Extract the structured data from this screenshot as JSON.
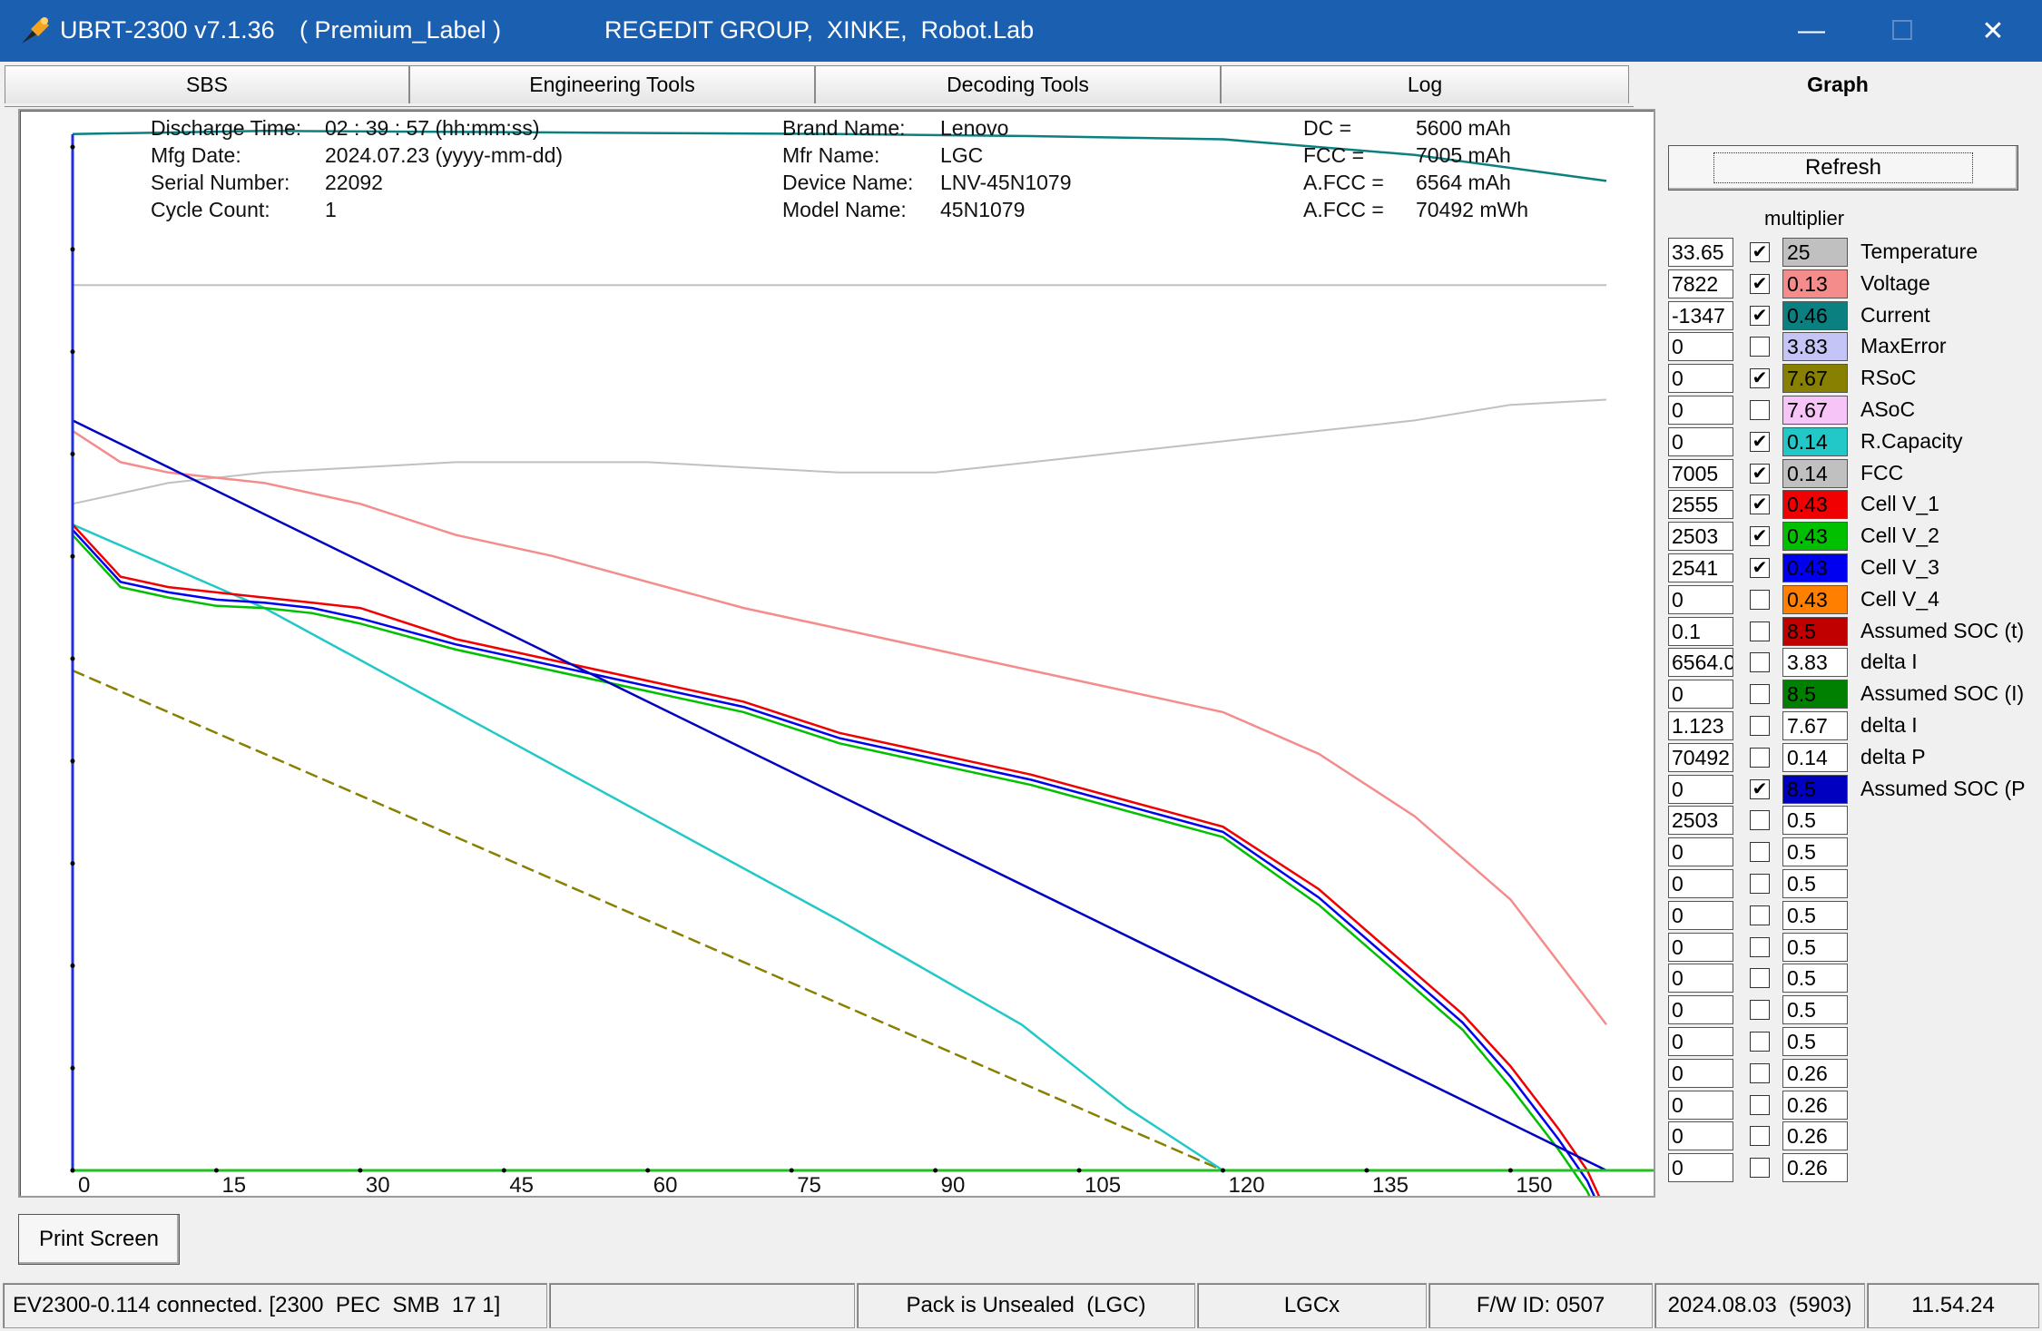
{
  "window": {
    "app_title": "UBRT-2300 v7.1.36",
    "label": "( Premium_Label )",
    "group": "REGEDIT GROUP,  XINKE,  Robot.Lab",
    "minimize": "—",
    "maximize": "☐",
    "close": "✕"
  },
  "tabs": [
    "SBS",
    "Engineering Tools",
    "Decoding Tools",
    "Log",
    "Graph"
  ],
  "active_tab": "Graph",
  "info": {
    "discharge_time_label": "Discharge Time:",
    "discharge_time_value": "02 : 39 : 57 (hh:mm:ss)",
    "mfg_date_label": "Mfg Date:",
    "mfg_date_value": "2024.07.23 (yyyy-mm-dd)",
    "serial_label": "Serial Number:",
    "serial_value": "22092",
    "cycle_label": "Cycle Count:",
    "cycle_value": "1",
    "brand_label": "Brand Name:",
    "brand_value": "Lenovo",
    "mfr_label": "Mfr Name:",
    "mfr_value": "LGC",
    "device_label": "Device Name:",
    "device_value": "LNV-45N1079",
    "model_label": "Model Name:",
    "model_value": "45N1079",
    "dc_label": "DC =",
    "dc_value": "5600 mAh",
    "fcc_label": "FCC =",
    "fcc_value": "7005 mAh",
    "afcc1_label": "A.FCC =",
    "afcc1_value": "6564 mAh",
    "afcc2_label": "A.FCC =",
    "afcc2_value": "70492 mWh"
  },
  "refresh_label": "Refresh",
  "multiplier_label": "multiplier",
  "channels": [
    {
      "value": "33.65",
      "checked": true,
      "mult": "25",
      "color": "#c0c0c0",
      "label": "Temperature"
    },
    {
      "value": "7822",
      "checked": true,
      "mult": "0.13",
      "color": "#f48c8c",
      "label": "Voltage"
    },
    {
      "value": "-1347",
      "checked": true,
      "mult": "0.46",
      "color": "#0b8080",
      "label": "Current"
    },
    {
      "value": "0",
      "checked": false,
      "mult": "3.83",
      "color": "#c4c4f6",
      "label": "MaxError"
    },
    {
      "value": "0",
      "checked": true,
      "mult": "7.67",
      "color": "#888000",
      "label": "RSoC"
    },
    {
      "value": "0",
      "checked": false,
      "mult": "7.67",
      "color": "#f6c4f6",
      "label": "ASoC"
    },
    {
      "value": "0",
      "checked": true,
      "mult": "0.14",
      "color": "#22c8c8",
      "label": "R.Capacity"
    },
    {
      "value": "7005",
      "checked": true,
      "mult": "0.14",
      "color": "#c0c0c0",
      "label": "FCC"
    },
    {
      "value": "2555",
      "checked": true,
      "mult": "0.43",
      "color": "#f00000",
      "label": "Cell V_1"
    },
    {
      "value": "2503",
      "checked": true,
      "mult": "0.43",
      "color": "#00c000",
      "label": "Cell V_2"
    },
    {
      "value": "2541",
      "checked": true,
      "mult": "0.43",
      "color": "#0000f0",
      "label": "Cell V_3"
    },
    {
      "value": "0",
      "checked": false,
      "mult": "0.43",
      "color": "#ff8000",
      "label": "Cell V_4"
    },
    {
      "value": "0.1",
      "checked": false,
      "mult": "8.5",
      "color": "#c00000",
      "label": "Assumed SOC (t)"
    },
    {
      "value": "6564.0",
      "checked": false,
      "mult": "3.83",
      "color": "#ffffff",
      "label": "delta I"
    },
    {
      "value": "0",
      "checked": false,
      "mult": "8.5",
      "color": "#008000",
      "label": "Assumed SOC (I)"
    },
    {
      "value": "1.123",
      "checked": false,
      "mult": "7.67",
      "color": "#ffffff",
      "label": "delta I"
    },
    {
      "value": "70492",
      "checked": false,
      "mult": "0.14",
      "color": "#ffffff",
      "label": "delta P"
    },
    {
      "value": "0",
      "checked": true,
      "mult": "8.5",
      "color": "#0000c0",
      "label": "Assumed SOC (P"
    },
    {
      "value": "2503",
      "checked": false,
      "mult": "0.5",
      "color": "#ffffff",
      "label": ""
    },
    {
      "value": "0",
      "checked": false,
      "mult": "0.5",
      "color": "#ffffff",
      "label": ""
    },
    {
      "value": "0",
      "checked": false,
      "mult": "0.5",
      "color": "#ffffff",
      "label": ""
    },
    {
      "value": "0",
      "checked": false,
      "mult": "0.5",
      "color": "#ffffff",
      "label": ""
    },
    {
      "value": "0",
      "checked": false,
      "mult": "0.5",
      "color": "#ffffff",
      "label": ""
    },
    {
      "value": "0",
      "checked": false,
      "mult": "0.5",
      "color": "#ffffff",
      "label": ""
    },
    {
      "value": "0",
      "checked": false,
      "mult": "0.5",
      "color": "#ffffff",
      "label": ""
    },
    {
      "value": "0",
      "checked": false,
      "mult": "0.5",
      "color": "#ffffff",
      "label": ""
    },
    {
      "value": "0",
      "checked": false,
      "mult": "0.26",
      "color": "#ffffff",
      "label": ""
    },
    {
      "value": "0",
      "checked": false,
      "mult": "0.26",
      "color": "#ffffff",
      "label": ""
    },
    {
      "value": "0",
      "checked": false,
      "mult": "0.26",
      "color": "#ffffff",
      "label": ""
    },
    {
      "value": "0",
      "checked": false,
      "mult": "0.26",
      "color": "#ffffff",
      "label": ""
    }
  ],
  "print_button": "Print Screen",
  "status": {
    "connection": "EV2300-0.114 connected. [2300  PEC  SMB  17 1]",
    "empty": "",
    "seal": "Pack is Unsealed  (LGC)",
    "chem": "LGCx",
    "fw": "F/W ID: 0507",
    "date": "2024.08.03  (5903)",
    "time": "11.54.24"
  },
  "chart_data": {
    "type": "line",
    "x_ticks": [
      "0",
      "15",
      "30",
      "45",
      "60",
      "75",
      "90",
      "105",
      "120",
      "135",
      "150"
    ],
    "xlim": [
      0,
      160
    ],
    "ylim": [
      0,
      100
    ],
    "series": [
      {
        "name": "Temperature",
        "color": "#c0c0c0",
        "x": [
          0,
          10,
          20,
          30,
          40,
          50,
          60,
          70,
          80,
          90,
          100,
          110,
          120,
          130,
          140,
          150,
          160
        ],
        "y": [
          64,
          66,
          67,
          67.5,
          68,
          68,
          68,
          67.5,
          67,
          67,
          68,
          69,
          70,
          71,
          72,
          73.5,
          74
        ]
      },
      {
        "name": "Voltage",
        "color": "#f48c8c",
        "x": [
          0,
          5,
          10,
          20,
          30,
          40,
          50,
          60,
          70,
          80,
          90,
          100,
          110,
          120,
          130,
          140,
          150,
          155,
          160
        ],
        "y": [
          71,
          68,
          67,
          66,
          64,
          61,
          59,
          56.5,
          54,
          52,
          50,
          48,
          46,
          44,
          40,
          34,
          26,
          20,
          14
        ]
      },
      {
        "name": "Current",
        "color": "#0b8080",
        "x": [
          0,
          20,
          40,
          60,
          80,
          100,
          120,
          140,
          160
        ],
        "y": [
          99.5,
          99.8,
          99.7,
          99.6,
          99.5,
          99.3,
          99,
          97.5,
          95
        ]
      },
      {
        "name": "RSoC",
        "color": "#888000",
        "x": [
          0,
          120
        ],
        "y": [
          48,
          0
        ]
      },
      {
        "name": "R.Capacity",
        "color": "#22c8c8",
        "x": [
          0,
          20,
          40,
          60,
          80,
          99,
          110,
          120
        ],
        "y": [
          62,
          54,
          44,
          34,
          24,
          14,
          6,
          0
        ]
      },
      {
        "name": "FCC",
        "color": "#c0c0c0",
        "x": [
          0,
          160
        ],
        "y": [
          85,
          85
        ]
      },
      {
        "name": "Cell V_1",
        "color": "#f00000",
        "x": [
          0,
          5,
          10,
          15,
          20,
          25,
          30,
          40,
          50,
          60,
          70,
          80,
          90,
          100,
          110,
          120,
          130,
          135,
          140,
          145,
          150,
          155,
          158,
          160
        ],
        "y": [
          62,
          57,
          56,
          55.5,
          55,
          54.5,
          54,
          51,
          49,
          47,
          45,
          42,
          40,
          38,
          35.5,
          33,
          27,
          23,
          19,
          15,
          10,
          4,
          0,
          -4
        ]
      },
      {
        "name": "Cell V_2",
        "color": "#00c000",
        "x": [
          0,
          5,
          10,
          15,
          20,
          25,
          30,
          40,
          50,
          60,
          70,
          80,
          90,
          100,
          110,
          120,
          130,
          135,
          140,
          145,
          150,
          155,
          158,
          160
        ],
        "y": [
          61,
          56,
          55,
          54.2,
          54,
          53.5,
          52.5,
          50,
          48,
          46,
          44,
          41,
          39,
          37,
          34.5,
          32,
          25.5,
          21.5,
          17.5,
          13.5,
          8,
          2,
          -2,
          -6
        ]
      },
      {
        "name": "Cell V_3",
        "color": "#0000f0",
        "x": [
          0,
          5,
          10,
          15,
          20,
          25,
          30,
          40,
          50,
          60,
          70,
          80,
          90,
          100,
          110,
          120,
          130,
          135,
          140,
          145,
          150,
          155,
          158,
          160
        ],
        "y": [
          61.5,
          56.5,
          55.5,
          54.8,
          54.5,
          54,
          53,
          50.5,
          48.5,
          46.5,
          44.5,
          41.5,
          39.5,
          37.5,
          35,
          32.5,
          26.2,
          22.2,
          18.2,
          14.2,
          9,
          3,
          -1,
          -5
        ]
      },
      {
        "name": "Assumed SOC (P",
        "color": "#0000c0",
        "x": [
          0,
          160
        ],
        "y": [
          72,
          0
        ]
      },
      {
        "name": "",
        "color": "#22c022",
        "x": [
          0,
          160
        ],
        "y": [
          0,
          0
        ]
      }
    ]
  }
}
